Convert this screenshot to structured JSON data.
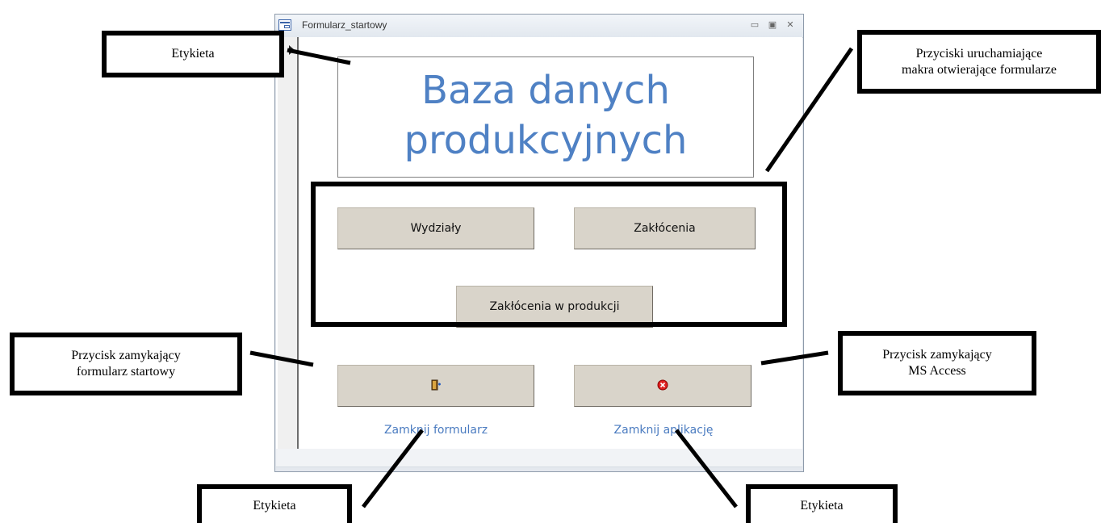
{
  "window": {
    "title": "Formularz_startowy",
    "controls": [
      "▭",
      "▣",
      "✕"
    ]
  },
  "form": {
    "heading_line1": "Baza danych",
    "heading_line2": "produkcyjnych",
    "buttons": {
      "wydzialy": "Wydziały",
      "zaklocenia": "Zakłócenia",
      "zaklocenia_w_produkcji": "Zakłócenia w produkcji"
    },
    "close_form_label": "Zamknij formularz",
    "close_app_label": "Zamknij aplikację",
    "heading_color": "#4f81c4"
  },
  "annotations": {
    "etykieta_top": "Etykieta",
    "przyciski_line1": "Przyciski uruchamiające",
    "przyciski_line2": "makra otwierające formularze",
    "zamyk_form_line1": "Przycisk zamykający",
    "zamyk_form_line2": "formularz startowy",
    "zamyk_access_line1": "Przycisk zamykający",
    "zamyk_access_line2": "MS Access",
    "etykieta_bottom_left": "Etykieta",
    "etykieta_bottom_right": "Etykieta"
  }
}
